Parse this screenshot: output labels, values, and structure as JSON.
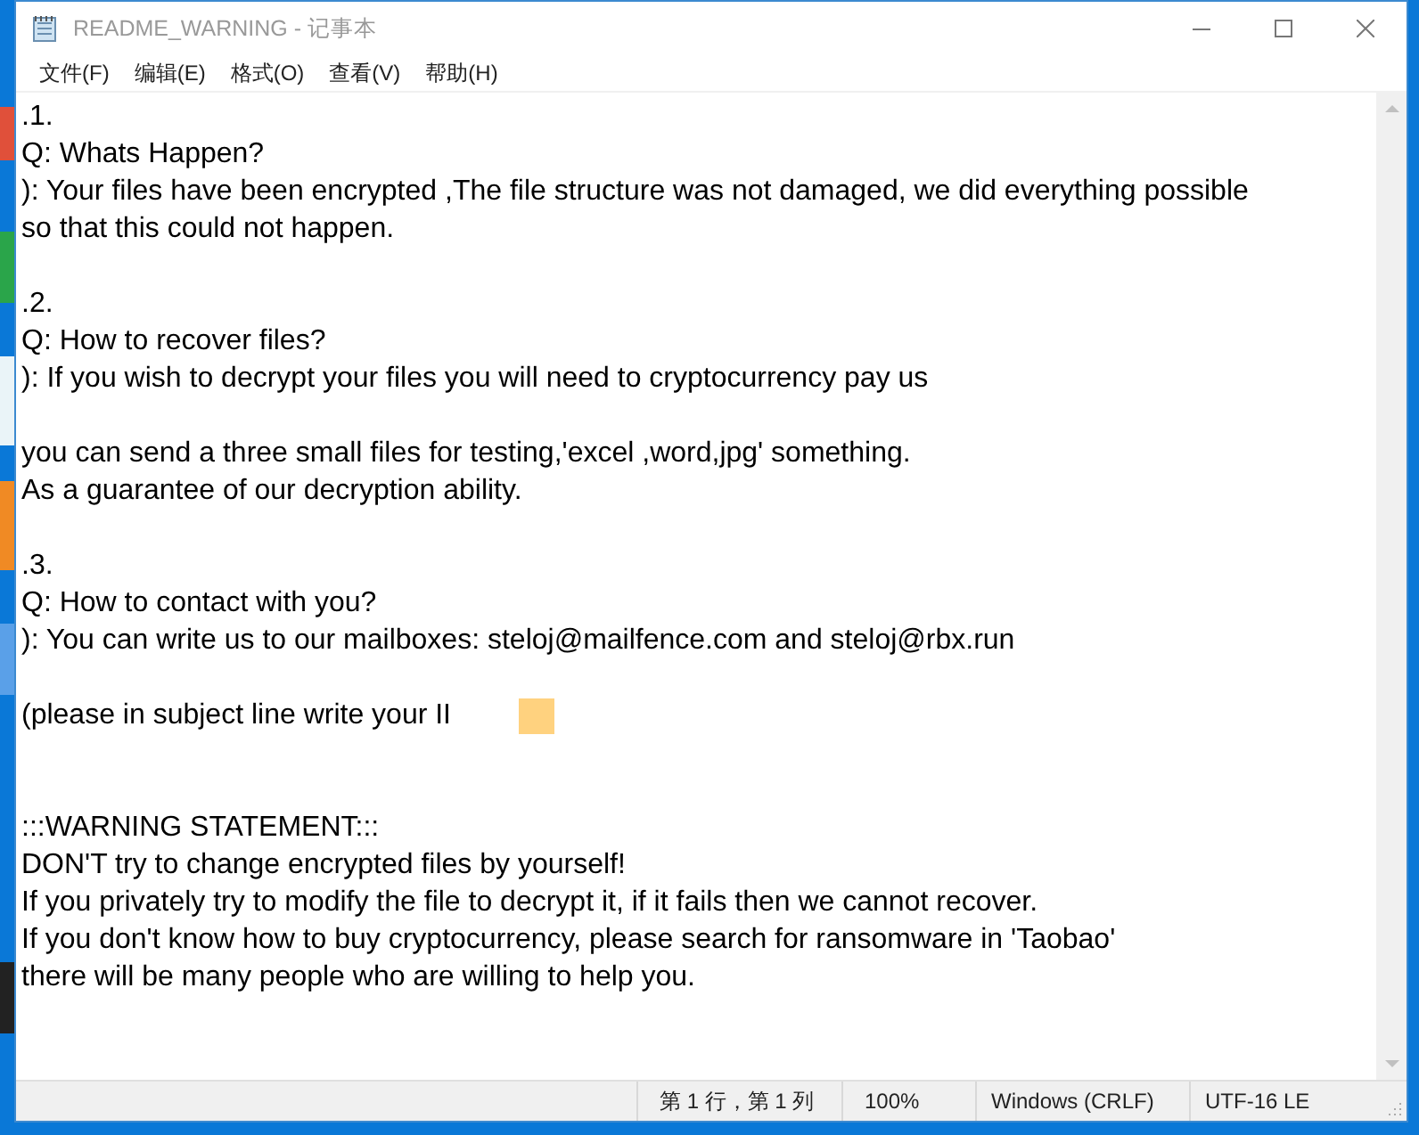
{
  "window": {
    "title": "README_WARNING - 记事本"
  },
  "menu": [
    "文件(F)",
    "编辑(E)",
    "格式(O)",
    "查看(V)",
    "帮助(H)"
  ],
  "document": {
    "lines": [
      {
        "kind": "text",
        "text": ".1."
      },
      {
        "kind": "text",
        "text": "Q: Whats Happen?"
      },
      {
        "kind": "text",
        "text": "): Your files have been encrypted ,The file structure was not damaged, we did everything possible"
      },
      {
        "kind": "text",
        "text": "so that this could not happen."
      },
      {
        "kind": "blank"
      },
      {
        "kind": "text",
        "text": ".2."
      },
      {
        "kind": "text",
        "text": "Q: How to recover files?"
      },
      {
        "kind": "text",
        "text": "): If you wish to decrypt your files you will need to cryptocurrency pay us"
      },
      {
        "kind": "blank"
      },
      {
        "kind": "text",
        "text": "you can send a three small files for testing,'excel ,word,jpg' something."
      },
      {
        "kind": "text",
        "text": "As a guarantee of our decryption ability."
      },
      {
        "kind": "blank"
      },
      {
        "kind": "text",
        "text": ".3."
      },
      {
        "kind": "text",
        "text": "Q: How to contact with you?"
      },
      {
        "kind": "text",
        "text": "): You can write us to our mailboxes: steloj@mailfence.com and steloj@rbx.run"
      },
      {
        "kind": "blank"
      },
      {
        "kind": "redacted",
        "text": "(please in subject line write your II"
      },
      {
        "kind": "blank"
      },
      {
        "kind": "blank"
      },
      {
        "kind": "text",
        "text": ":::WARNING STATEMENT:::"
      },
      {
        "kind": "text",
        "text": "DON'T try to change encrypted files by yourself!"
      },
      {
        "kind": "text",
        "text": "If you privately try to modify the file to decrypt it, if it fails then we cannot recover."
      },
      {
        "kind": "text",
        "text": "If you don't know how to buy cryptocurrency, please search for ransomware in 'Taobao'"
      },
      {
        "kind": "text",
        "text": "there will be many people who are willing to help you."
      }
    ]
  },
  "status_bar": {
    "position": "第 1 行，第 1 列",
    "zoom": "100%",
    "line_ending": "Windows (CRLF)",
    "encoding": "UTF-16 LE"
  }
}
